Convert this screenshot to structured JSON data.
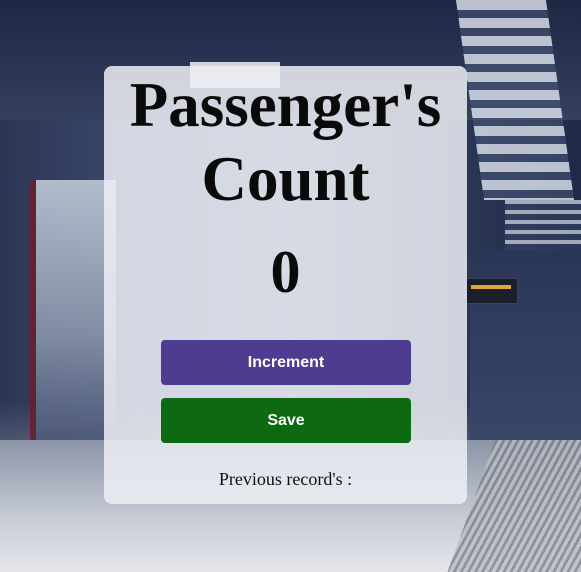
{
  "app": {
    "title_line1": "Passenger's",
    "title_line2": "Count"
  },
  "counter": {
    "value": "0"
  },
  "buttons": {
    "increment_label": "Increment",
    "save_label": "Save"
  },
  "records": {
    "label": "Previous record's :",
    "entries": ""
  },
  "colors": {
    "increment_button": "#4d3c8f",
    "save_button": "#0d6a12",
    "card_background": "#eceff4",
    "text": "#0a0a0a"
  }
}
